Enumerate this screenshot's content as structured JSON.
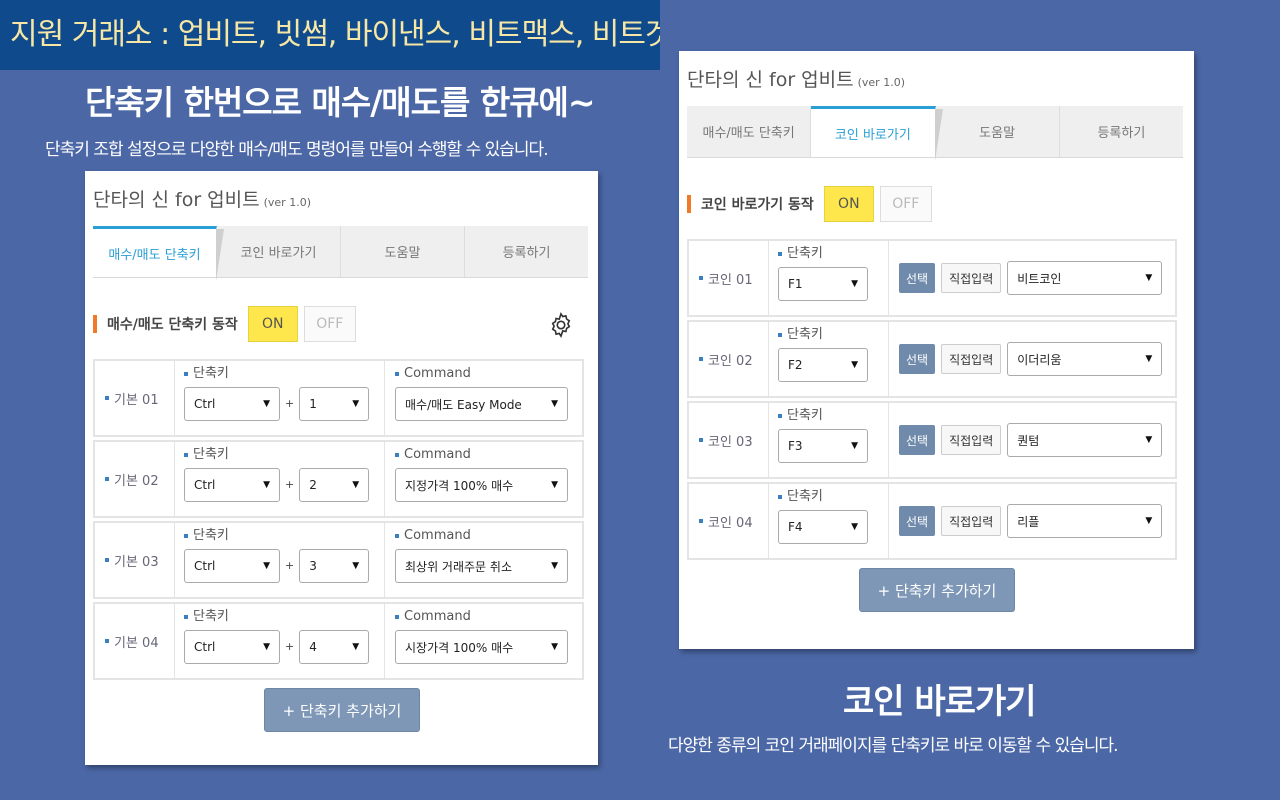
{
  "banner": {
    "text": "지원 거래소 : 업비트, 빗썸, 바이낸스, 비트맥스, 비트겟"
  },
  "left_promo": {
    "headline": "단축키 한번으로 매수/매도를 한큐에~",
    "subline": "단축키 조합 설정으로 다양한 매수/매도 명령어를 만들어 수행할 수 있습니다."
  },
  "right_promo": {
    "headline": "코인 바로가기",
    "subline": "다양한 종류의 코인 거래페이지를 단축키로 바로 이동할 수 있습니다."
  },
  "panel_common": {
    "title": "단타의 신 for 업비트",
    "version": "(ver 1.0)",
    "tabs": [
      "매수/매도 단축키",
      "코인 바로가기",
      "도움말",
      "등록하기"
    ],
    "on_label": "ON",
    "off_label": "OFF",
    "hotkey_label": "단축키",
    "command_label": "Command",
    "plus": "+",
    "add_button": "+ 단축키 추가하기",
    "choose_label": "선택",
    "direct_label": "직접입력"
  },
  "left_panel": {
    "active_tab": 0,
    "toggle_label": "매수/매도 단축키 동작",
    "rows": [
      {
        "name": "기본 01",
        "modifier": "Ctrl",
        "key": "1",
        "command": "매수/매도 Easy Mode"
      },
      {
        "name": "기본 02",
        "modifier": "Ctrl",
        "key": "2",
        "command": "지정가격 100% 매수"
      },
      {
        "name": "기본 03",
        "modifier": "Ctrl",
        "key": "3",
        "command": "최상위 거래주문 취소"
      },
      {
        "name": "기본 04",
        "modifier": "Ctrl",
        "key": "4",
        "command": "시장가격 100% 매수"
      }
    ]
  },
  "right_panel": {
    "active_tab": 1,
    "toggle_label": "코인 바로가기 동작",
    "rows": [
      {
        "name": "코인 01",
        "key": "F1",
        "coin": "비트코인"
      },
      {
        "name": "코인 02",
        "key": "F2",
        "coin": "이더리움"
      },
      {
        "name": "코인 03",
        "key": "F3",
        "coin": "퀀텀"
      },
      {
        "name": "코인 04",
        "key": "F4",
        "coin": "리플"
      }
    ]
  },
  "colors": {
    "background": "#4b67a6",
    "banner": "#0f4a8c",
    "accent_tab": "#2a9fd6",
    "on_button": "#fde74c",
    "marker": "#f07a2a"
  }
}
